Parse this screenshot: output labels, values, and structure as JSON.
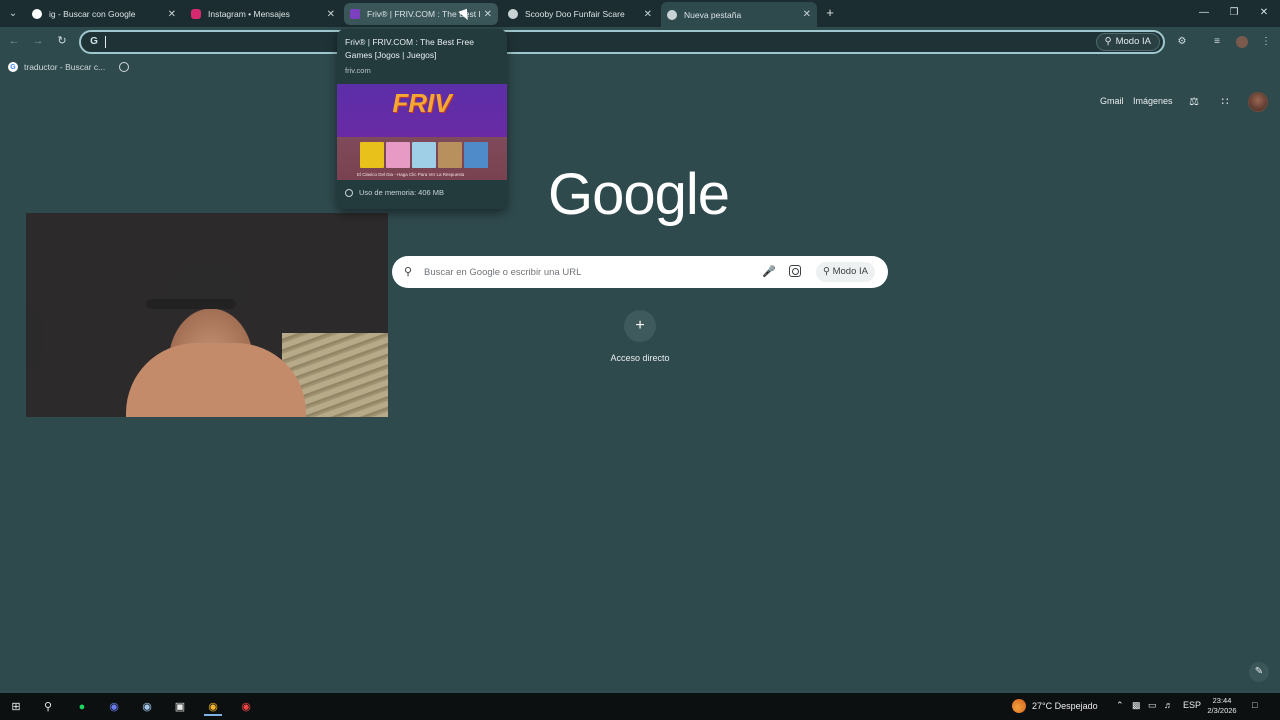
{
  "tabs": [
    {
      "title": "ig - Buscar con Google",
      "favicon": "google-icon",
      "color": "#ffffff"
    },
    {
      "title": "Instagram • Mensajes",
      "favicon": "instagram-icon",
      "color": "#d6296f"
    },
    {
      "title": "Friv® | FRIV.COM : The Best F...",
      "favicon": "friv-icon",
      "color": "#7b3fbf"
    },
    {
      "title": "Scooby Doo Funfair Scare",
      "favicon": "scooby-icon",
      "color": "#c9d3d5"
    },
    {
      "title": "Nueva pestaña",
      "favicon": "chrome-icon",
      "color": "#c9d3d5"
    }
  ],
  "toolbar": {
    "modo_ia": "Modo IA"
  },
  "bookmarks": [
    {
      "label": "traductor - Buscar c..."
    }
  ],
  "hovercard": {
    "title": "Friv® | FRIV.COM : The Best Free Games [Jogos | Juegos]",
    "domain": "friv.com",
    "preview_logo": "FRIV",
    "preview_caption": "El Clasico Del Dia - Haga Clic Para Ver La Respuesta",
    "memory": "Uso de memoria: 406 MB"
  },
  "google": {
    "logo": "Google",
    "gmail": "Gmail",
    "images": "Imágenes",
    "search_placeholder": "Buscar en Google o escribir una URL",
    "modo_ia": "Modo IA",
    "shortcut_label": "Acceso directo"
  },
  "taskbar": {
    "weather": "27°C  Despejado",
    "lang": "ESP",
    "time": "23:44",
    "date": "2/3/2026"
  }
}
